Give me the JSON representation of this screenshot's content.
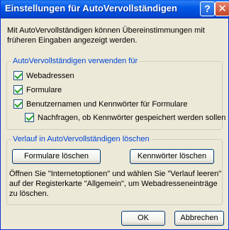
{
  "window": {
    "title": "Einstellungen für AutoVervollständigen",
    "help_button": "?",
    "close_button": "✕"
  },
  "intro_text": "Mit AutoVervollständigen können Übereinstimmungen mit früheren Eingaben angezeigt werden.",
  "use_group": {
    "legend": "AutoVervollständigen verwenden für",
    "options": [
      {
        "label": "Webadressen",
        "checked": true
      },
      {
        "label": "Formulare",
        "checked": true
      },
      {
        "label": "Benutzernamen und Kennwörter für Formulare",
        "checked": true
      },
      {
        "label": "Nachfragen, ob Kennwörter gespeichert werden sollen",
        "checked": true
      }
    ]
  },
  "history_group": {
    "legend": "Verlauf in AutoVervollständigen löschen",
    "clear_forms_button": "Formulare löschen",
    "clear_passwords_button": "Kennwörter löschen",
    "hint": "Öffnen Sie \"Internetoptionen\" und wählen Sie \"Verlauf leeren\" auf der Registerkarte \"Allgemein\", um Webadresseneinträge zu löschen."
  },
  "footer": {
    "ok_button": "OK",
    "cancel_button": "Abbrechen"
  }
}
